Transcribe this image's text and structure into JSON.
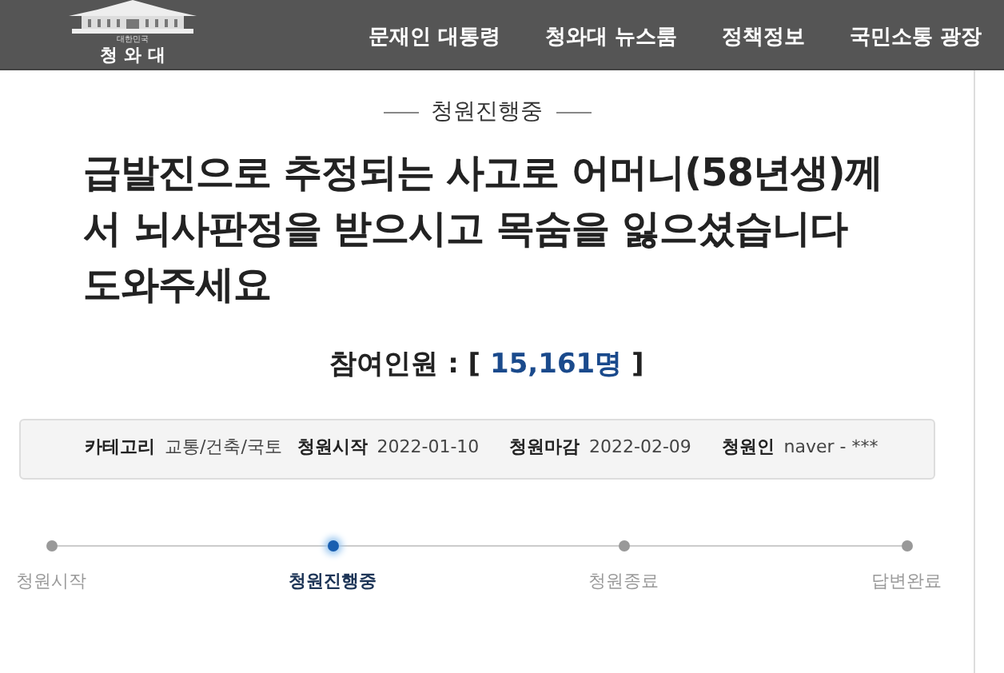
{
  "header": {
    "logo": {
      "caption": "대한민국",
      "name": "청 와 대"
    },
    "nav": [
      "문재인 대통령",
      "청와대 뉴스룸",
      "정책정보",
      "국민소통 광장"
    ]
  },
  "status": "청원진행중",
  "title": "급발진으로 추정되는 사고로 어머니(58년생)께서 뇌사판정을 받으시고 목숨을 잃으셨습니다 도와주세요",
  "participants": {
    "label": "참여인원 : [",
    "count": "15,161명",
    "close": "]"
  },
  "info": [
    {
      "label": "카테고리",
      "value": "교통/건축/국토"
    },
    {
      "label": "청원시작",
      "value": "2022-01-10"
    },
    {
      "label": "청원마감",
      "value": "2022-02-09"
    },
    {
      "label": "청원인",
      "value": "naver - ***"
    }
  ],
  "steps": [
    {
      "label": "청원시작",
      "selected": false
    },
    {
      "label": "청원진행중",
      "selected": true
    },
    {
      "label": "청원종료",
      "selected": false
    },
    {
      "label": "답변완료",
      "selected": false
    }
  ]
}
